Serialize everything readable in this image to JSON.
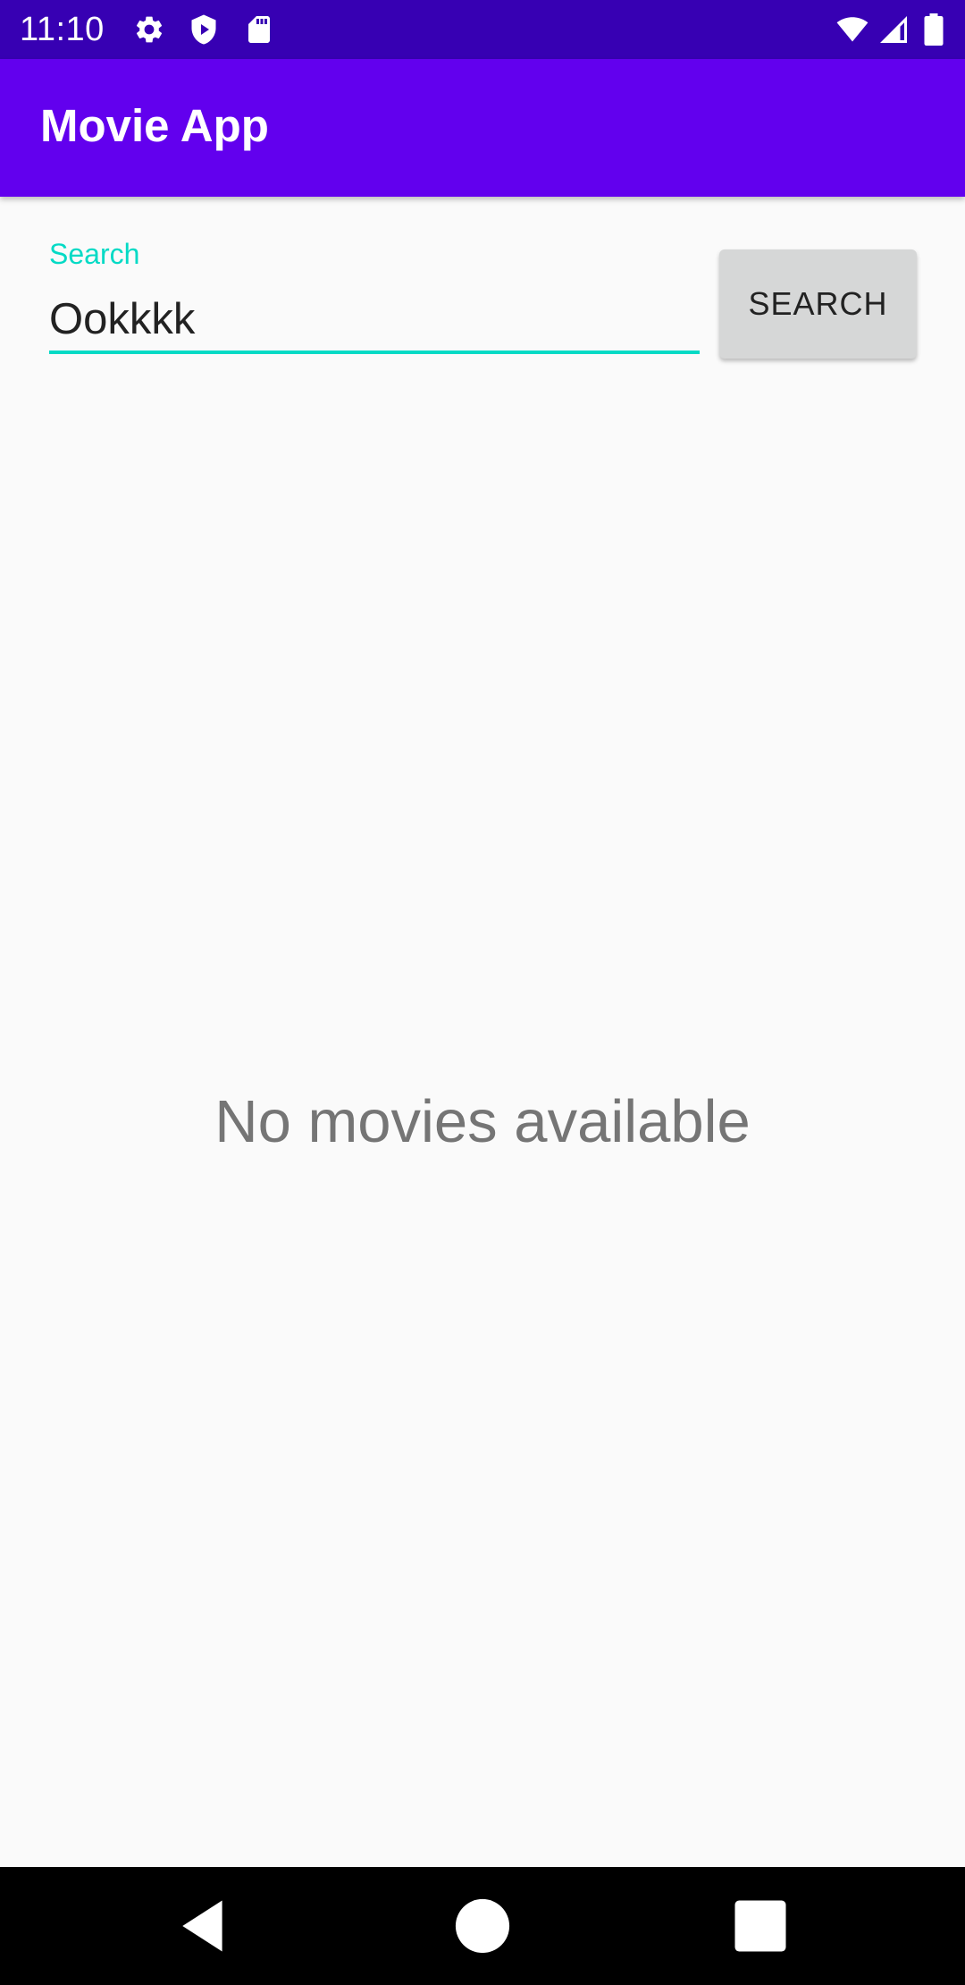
{
  "status_bar": {
    "time": "11:10",
    "icons": [
      "gear-icon",
      "shield-play-icon",
      "sd-card-icon",
      "wifi-icon",
      "cellular-signal-icon",
      "battery-icon"
    ]
  },
  "app_bar": {
    "title": "Movie App",
    "color": "#6200ee"
  },
  "search": {
    "label": "Search",
    "value": "Ookkkk",
    "button_label": "SEARCH",
    "accent_color": "#03dac5"
  },
  "main": {
    "empty_message": "No movies available"
  },
  "nav_bar": {
    "icons": [
      "back-icon",
      "home-icon",
      "recents-icon"
    ]
  }
}
